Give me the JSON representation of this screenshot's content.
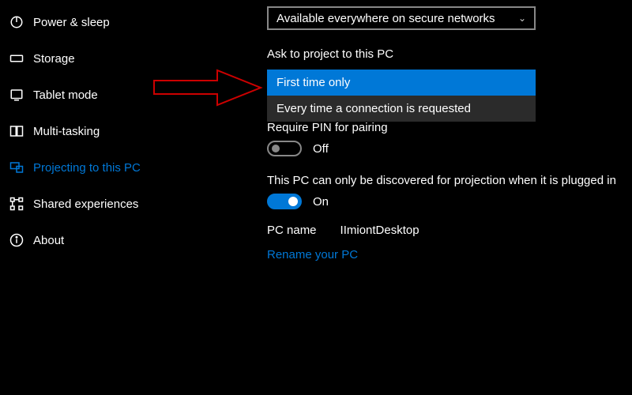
{
  "sidebar": {
    "items": [
      {
        "label": "Power & sleep"
      },
      {
        "label": "Storage"
      },
      {
        "label": "Tablet mode"
      },
      {
        "label": "Multi-tasking"
      },
      {
        "label": "Projecting to this PC"
      },
      {
        "label": "Shared experiences"
      },
      {
        "label": "About"
      }
    ]
  },
  "main": {
    "availability_combo": "Available everywhere on secure networks",
    "ask_label": "Ask to project to this PC",
    "ask_options": [
      {
        "label": "First time only"
      },
      {
        "label": "Every time a connection is requested"
      }
    ],
    "pin_label": "Require PIN for pairing",
    "pin_toggle_state": "Off",
    "discover_label": "This PC can only be discovered for projection when it is plugged in",
    "discover_toggle_state": "On",
    "pcname_label": "PC name",
    "pcname_value": "IImiontDesktop",
    "rename_link": "Rename your PC"
  }
}
